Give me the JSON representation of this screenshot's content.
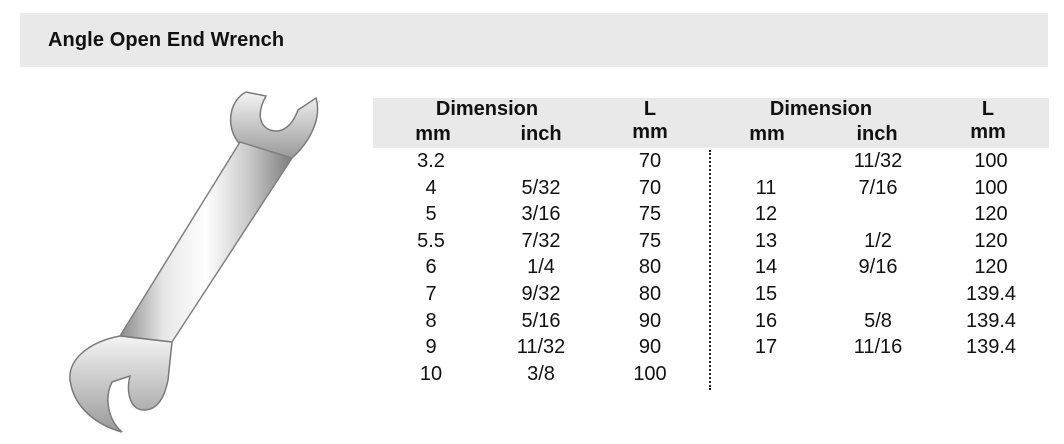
{
  "header": {
    "title": "Angle Open End Wrench"
  },
  "table": {
    "headers": {
      "dimension": "Dimension",
      "mm": "mm",
      "inch": "inch",
      "length": "L",
      "length_unit": "mm"
    },
    "left_rows": [
      {
        "mm": "3.2",
        "inch": "",
        "l": "70"
      },
      {
        "mm": "4",
        "inch": "5/32",
        "l": "70"
      },
      {
        "mm": "5",
        "inch": "3/16",
        "l": "75"
      },
      {
        "mm": "5.5",
        "inch": "7/32",
        "l": "75"
      },
      {
        "mm": "6",
        "inch": "1/4",
        "l": "80"
      },
      {
        "mm": "7",
        "inch": "9/32",
        "l": "80"
      },
      {
        "mm": "8",
        "inch": "5/16",
        "l": "90"
      },
      {
        "mm": "9",
        "inch": "11/32",
        "l": "90"
      },
      {
        "mm": "10",
        "inch": "3/8",
        "l": "100"
      }
    ],
    "right_rows": [
      {
        "mm": "",
        "inch": "11/32",
        "l": "100"
      },
      {
        "mm": "11",
        "inch": "7/16",
        "l": "100"
      },
      {
        "mm": "12",
        "inch": "",
        "l": "120"
      },
      {
        "mm": "13",
        "inch": "1/2",
        "l": "120"
      },
      {
        "mm": "14",
        "inch": "9/16",
        "l": "120"
      },
      {
        "mm": "15",
        "inch": "",
        "l": "139.4"
      },
      {
        "mm": "16",
        "inch": "5/8",
        "l": "139.4"
      },
      {
        "mm": "17",
        "inch": "11/16",
        "l": "139.4"
      }
    ]
  },
  "image": {
    "icon": "wrench-icon"
  }
}
